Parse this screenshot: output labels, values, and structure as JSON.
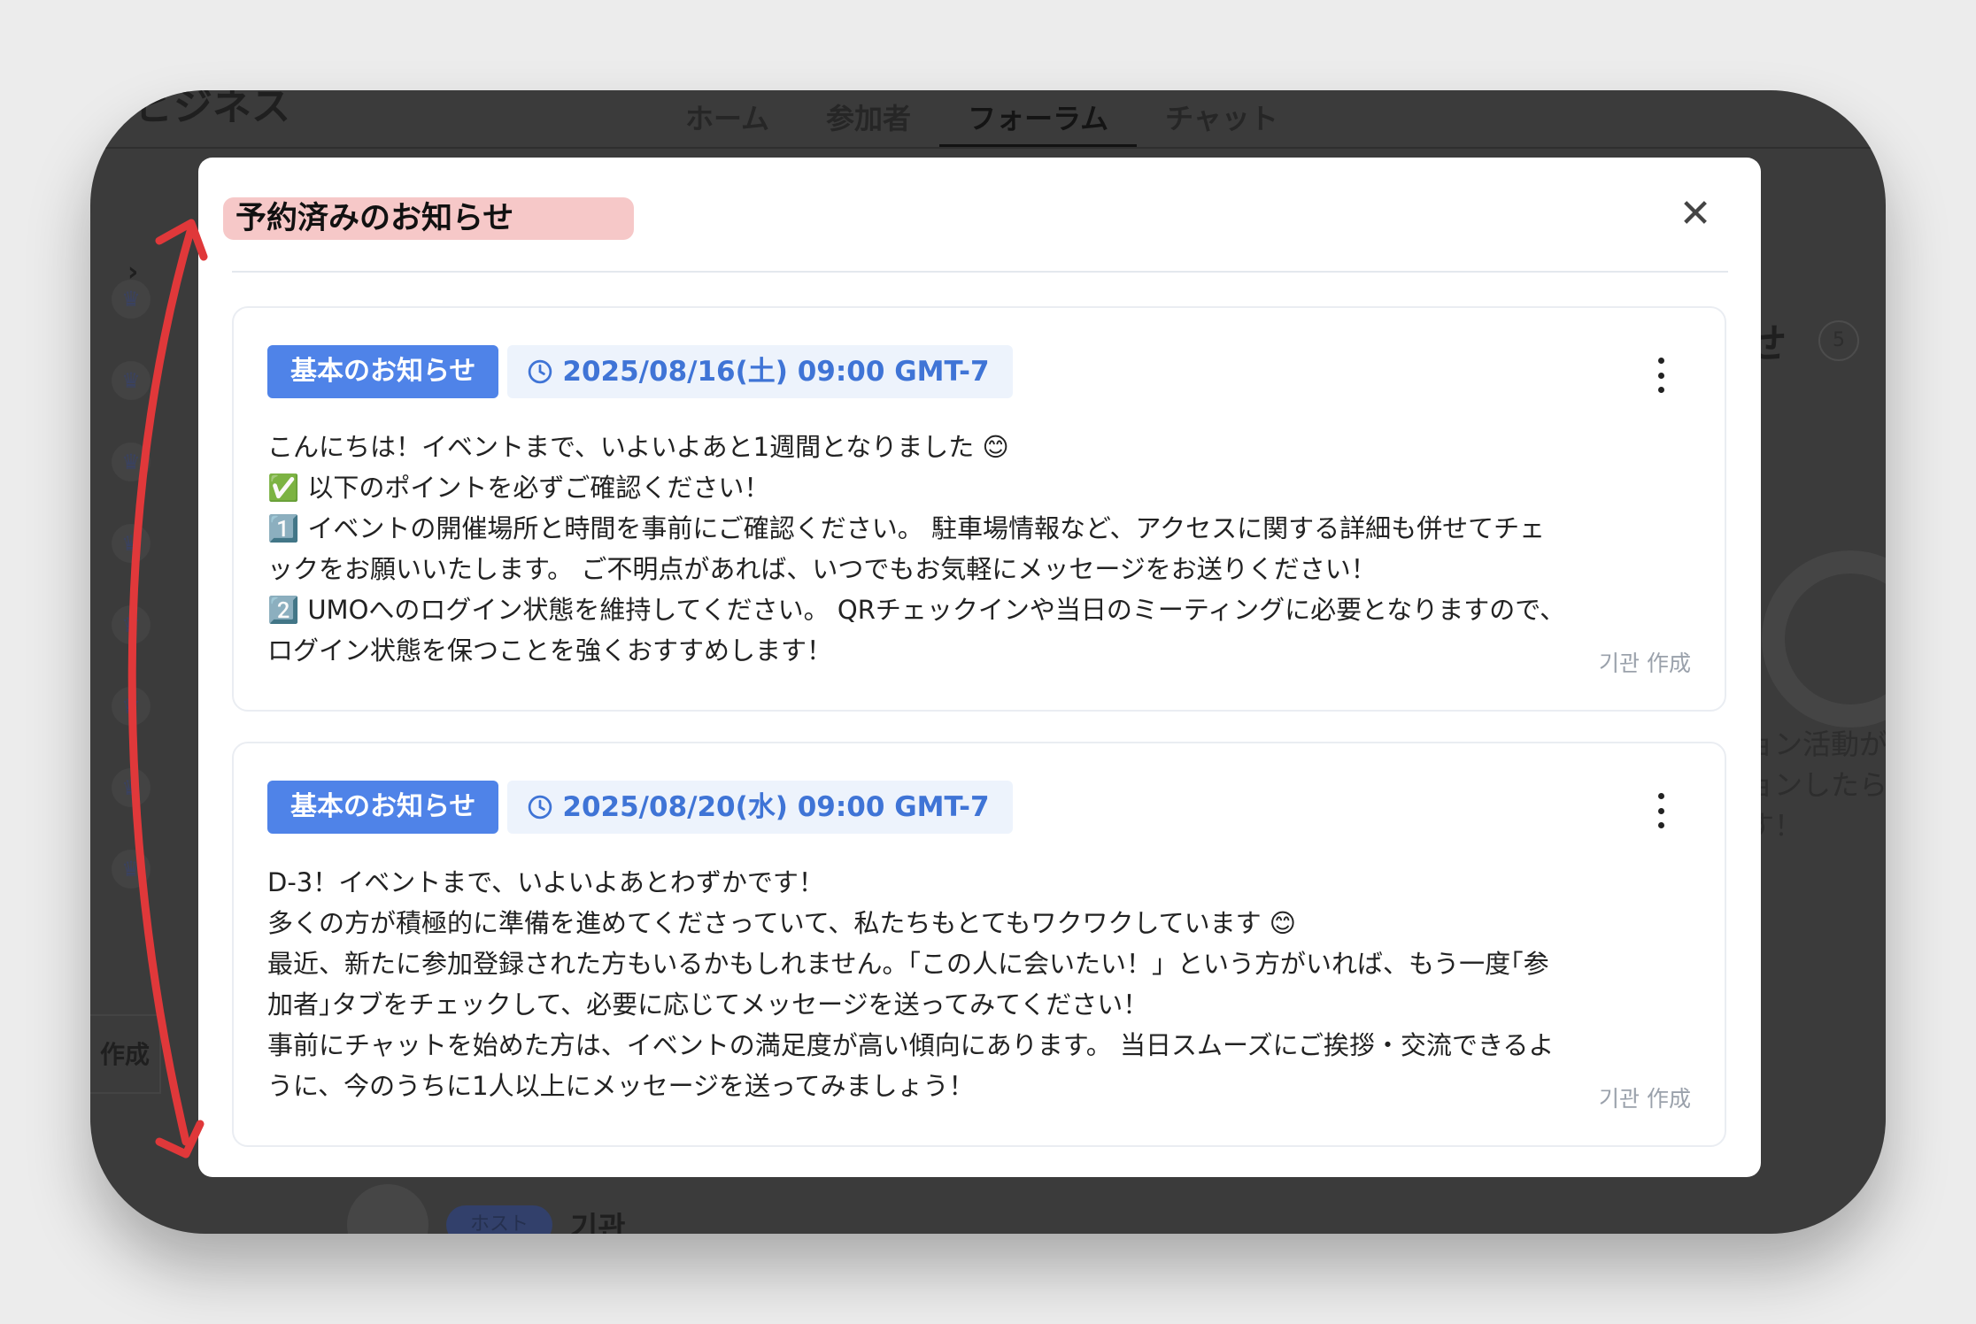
{
  "background_app": {
    "brand": "ビジネス",
    "nav": [
      {
        "label": "ホーム"
      },
      {
        "label": "参加者"
      },
      {
        "label": "フォーラム",
        "active": true
      },
      {
        "label": "チャット"
      }
    ],
    "sidebar_toggle": "›",
    "sidebar_create_label": "作成",
    "heading": "せ",
    "heading_count": "5",
    "empty_text": "ョン活動が\nョンしたら\nす！",
    "row_badge": "ホスト",
    "row_name": "기관"
  },
  "modal": {
    "title": "予約済みのお知らせ",
    "close_icon": "✕",
    "notices": [
      {
        "type_label": "基本のお知らせ",
        "datetime": "2025/08/16(土) 09:00 GMT-7",
        "body": "こんにちは！イベントまで、いよいよあと1週間となりました 😊\n✅ 以下のポイントを必ずご確認ください！\n1️⃣ イベントの開催場所と時間を事前にご確認ください。 駐車場情報など、アクセスに関する詳細も併せてチェックをお願いいたします。 ご不明点があれば、いつでもお気軽にメッセージをお送りください！\n2️⃣ UMOへのログイン状態を維持してください。 QRチェックインや当日のミーティングに必要となりますので、ログイン状態を保つことを強くおすすめします！",
        "author": "기관 作成"
      },
      {
        "type_label": "基本のお知らせ",
        "datetime": "2025/08/20(水) 09:00 GMT-7",
        "body": "D-3！イベントまで、いよいよあとわずかです！\n多くの方が積極的に準備を進めてくださっていて、私たちもとてもワクワクしています 😊\n最近、新たに参加登録された方もいるかもしれません。「この人に会いたい！」という方がいれば、もう一度｢参加者｣タブをチェックして、必要に応じてメッセージを送ってみてください！\n事前にチャットを始めた方は、イベントの満足度が高い傾向にあります。 当日スムーズにご挨拶・交流できるように、今のうちに1人以上にメッセージを送ってみましょう！",
        "author": "기관 作成"
      }
    ]
  },
  "colors": {
    "title_highlight": "#f6c8c8",
    "tag_primary": "#4f83e8",
    "tag_date_bg": "#edf3fc",
    "tag_date_text": "#3f74d6",
    "annotation_arrow": "#e0383a"
  },
  "icons": {
    "clock": "clock-icon",
    "more": "more-vertical-icon",
    "close": "close-icon",
    "sidebar": "crown-icon"
  }
}
